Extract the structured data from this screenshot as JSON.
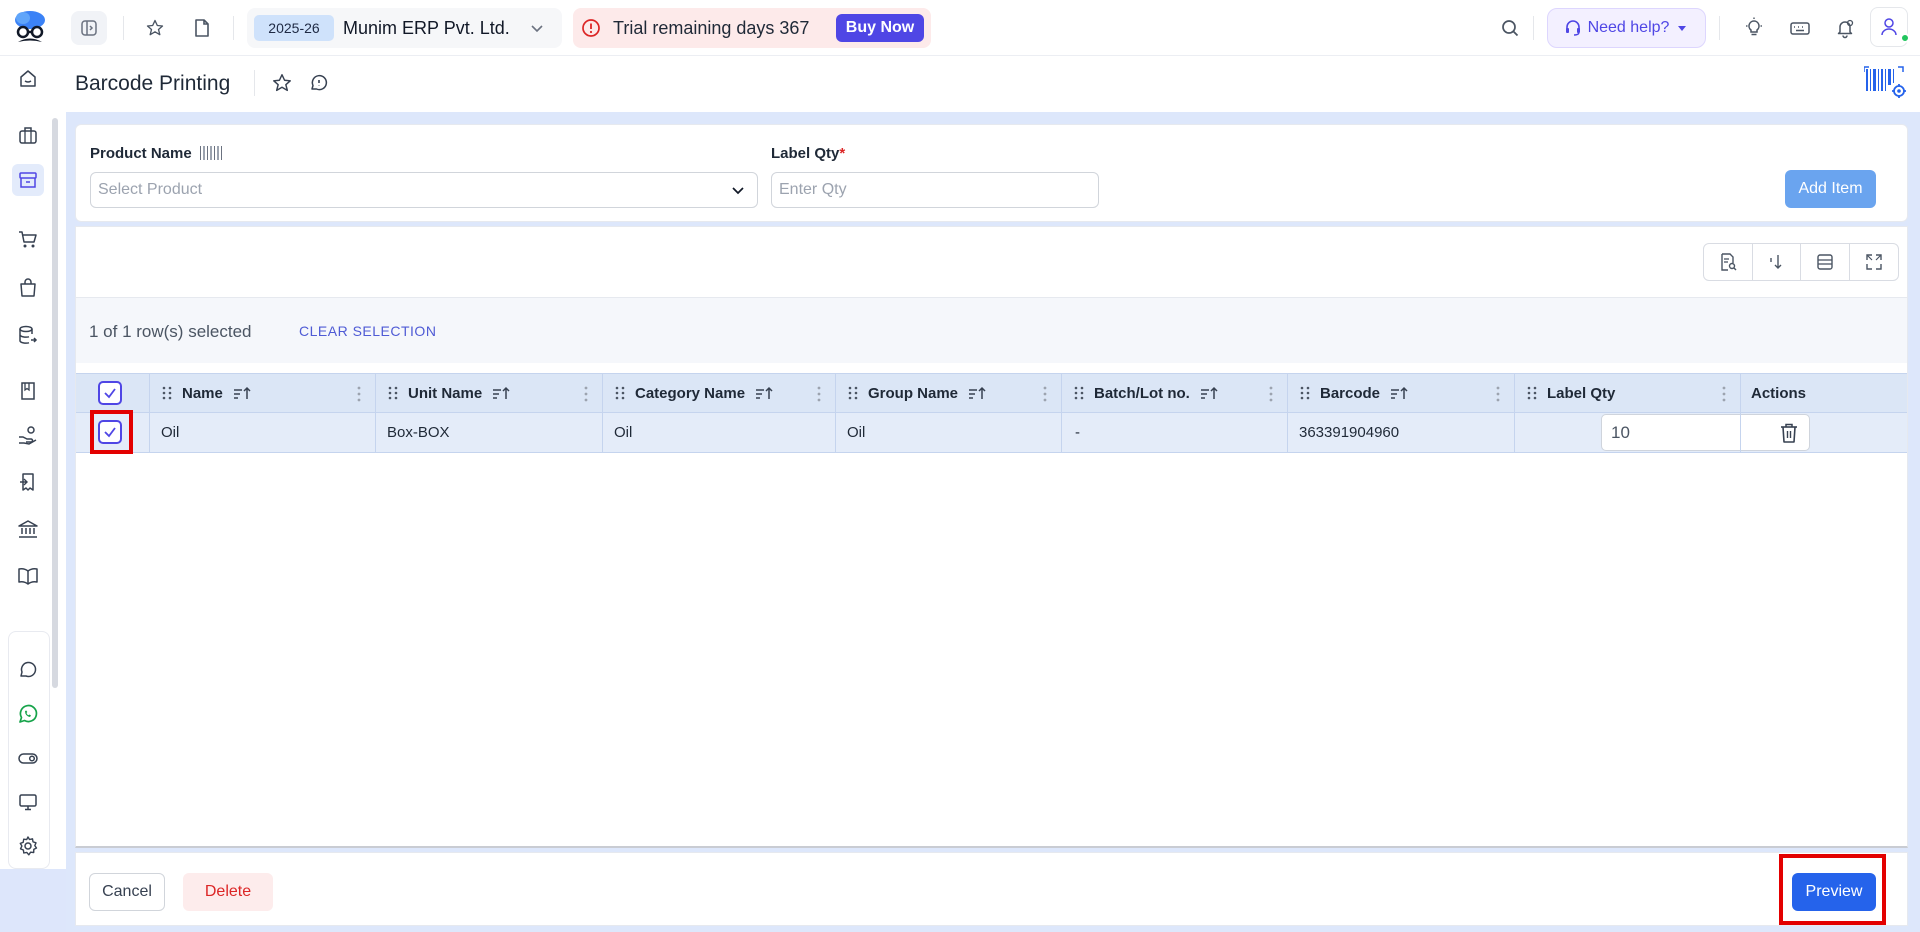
{
  "topbar": {
    "financial_year": "2025-26",
    "company": "Munim ERP Pvt. Ltd.",
    "trial_text": "Trial remaining days 367",
    "buy_now": "Buy Now",
    "need_help": "Need help?"
  },
  "page": {
    "title": "Barcode Printing"
  },
  "form": {
    "product_label": "Product Name",
    "product_placeholder": "Select Product",
    "qty_label": "Label Qty",
    "qty_required_mark": "*",
    "qty_placeholder": "Enter Qty",
    "add_item": "Add Item"
  },
  "table": {
    "selection_text": "1 of 1 row(s) selected",
    "clear_selection": "CLEAR SELECTION",
    "columns": {
      "name": "Name",
      "unit": "Unit Name",
      "category": "Category Name",
      "group": "Group Name",
      "batch": "Batch/Lot no.",
      "barcode": "Barcode",
      "label_qty": "Label Qty",
      "actions": "Actions"
    },
    "rows": [
      {
        "name": "Oil",
        "unit": "Box-BOX",
        "category": "Oil",
        "group": "Oil",
        "batch": "-",
        "barcode": "363391904960",
        "label_qty": "10"
      }
    ]
  },
  "footer": {
    "cancel": "Cancel",
    "delete": "Delete",
    "preview": "Preview"
  },
  "colors": {
    "accent": "#4f46e5",
    "primary_button": "#2563eb",
    "highlight": "#e30000",
    "selected_row": "#e4ecf9"
  }
}
